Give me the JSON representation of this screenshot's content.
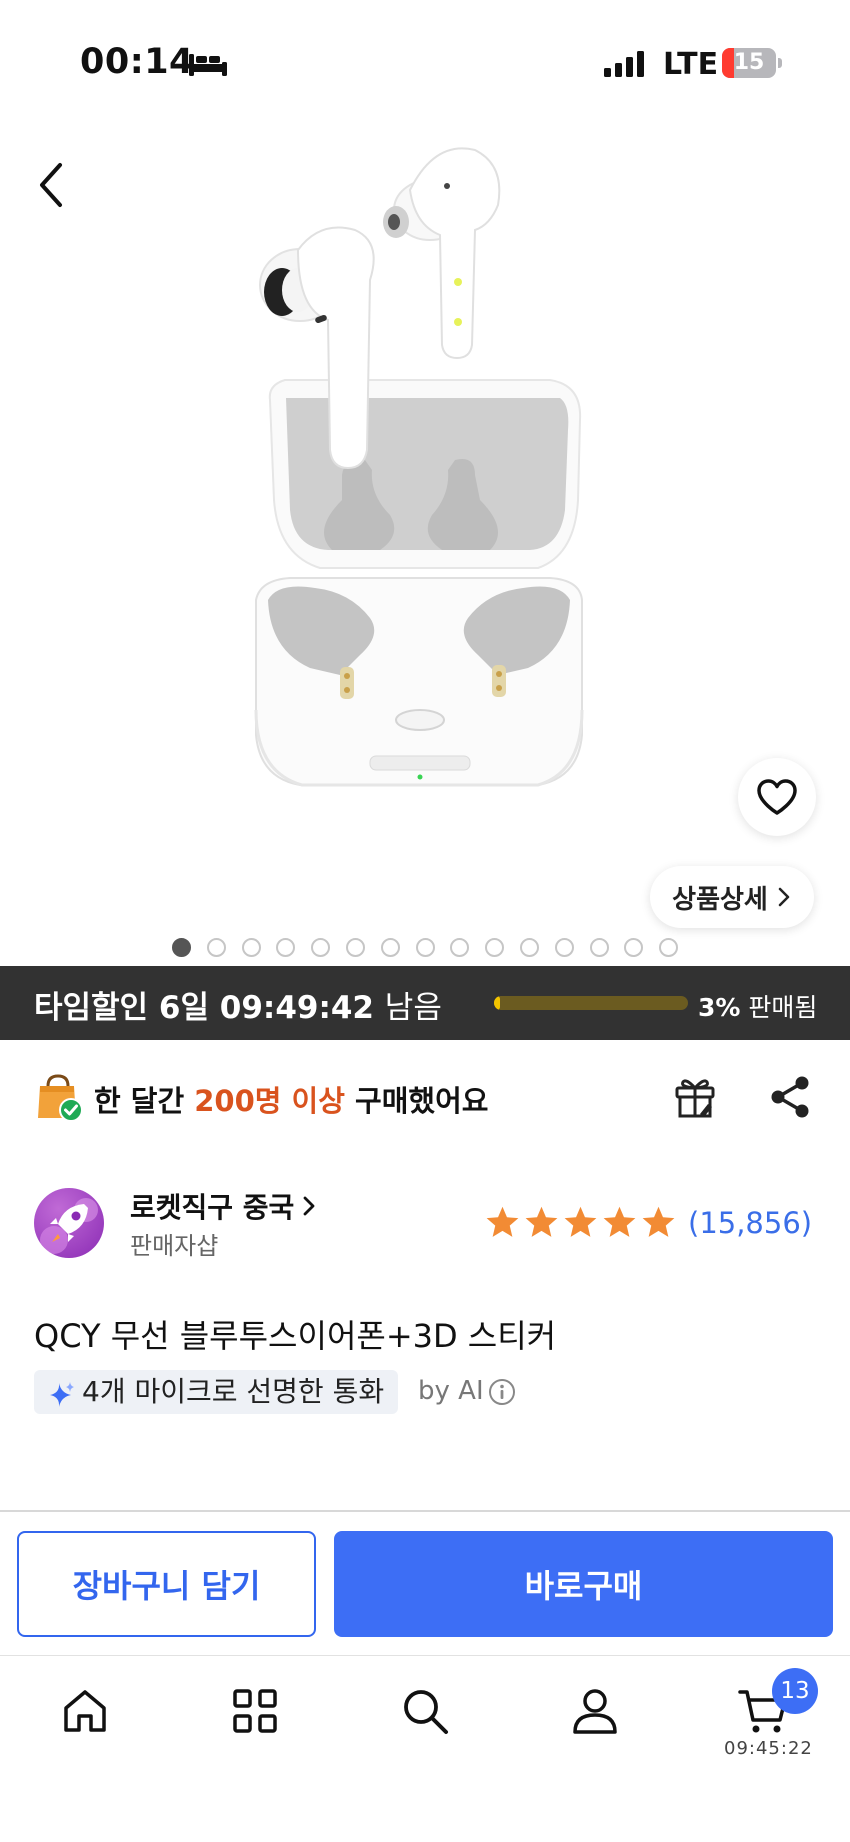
{
  "status_bar": {
    "time": "00:14",
    "network": "LTE",
    "battery": "15",
    "icons": [
      "bed-icon",
      "signal-icon",
      "battery-icon"
    ]
  },
  "gallery": {
    "image_count": 15,
    "active_index": 0,
    "detail_label": "상품상세",
    "icons": [
      "back-icon",
      "heart-icon",
      "chevron-right-icon"
    ]
  },
  "time_sale": {
    "label": "타임할인",
    "days": "6일",
    "countdown": "09:49:42",
    "suffix": "남음",
    "sold_percent": 3,
    "sold_value": "3%",
    "sold_suffix": "판매됨"
  },
  "purchase_info": {
    "prefix": "한 달간",
    "highlight": "200명 이상",
    "suffix": "구매했어요",
    "icons": [
      "shopping-bag-check-icon",
      "gift-icon",
      "share-icon"
    ]
  },
  "seller": {
    "name": "로켓직구 중국",
    "type": "판매자샵",
    "rating_stars": 5,
    "review_count": "(15,856)"
  },
  "product": {
    "title": "QCY 무선 블루투스이어폰+3D 스티커",
    "ai_feature": "4개 마이크로 선명한 통화",
    "ai_label": "by AI"
  },
  "actions": {
    "add_to_cart": "장바구니 담기",
    "buy_now": "바로구매"
  },
  "bottom_nav": {
    "items": [
      "home-icon",
      "categories-icon",
      "search-icon",
      "profile-icon",
      "cart-icon"
    ],
    "cart_badge": "13",
    "clock": "09:45:22"
  },
  "colors": {
    "accent": "#3d6ef5",
    "time_sale_bg": "#323232",
    "highlight": "#d9531e",
    "star": "#f28b34",
    "review_link": "#3a6ee8"
  }
}
